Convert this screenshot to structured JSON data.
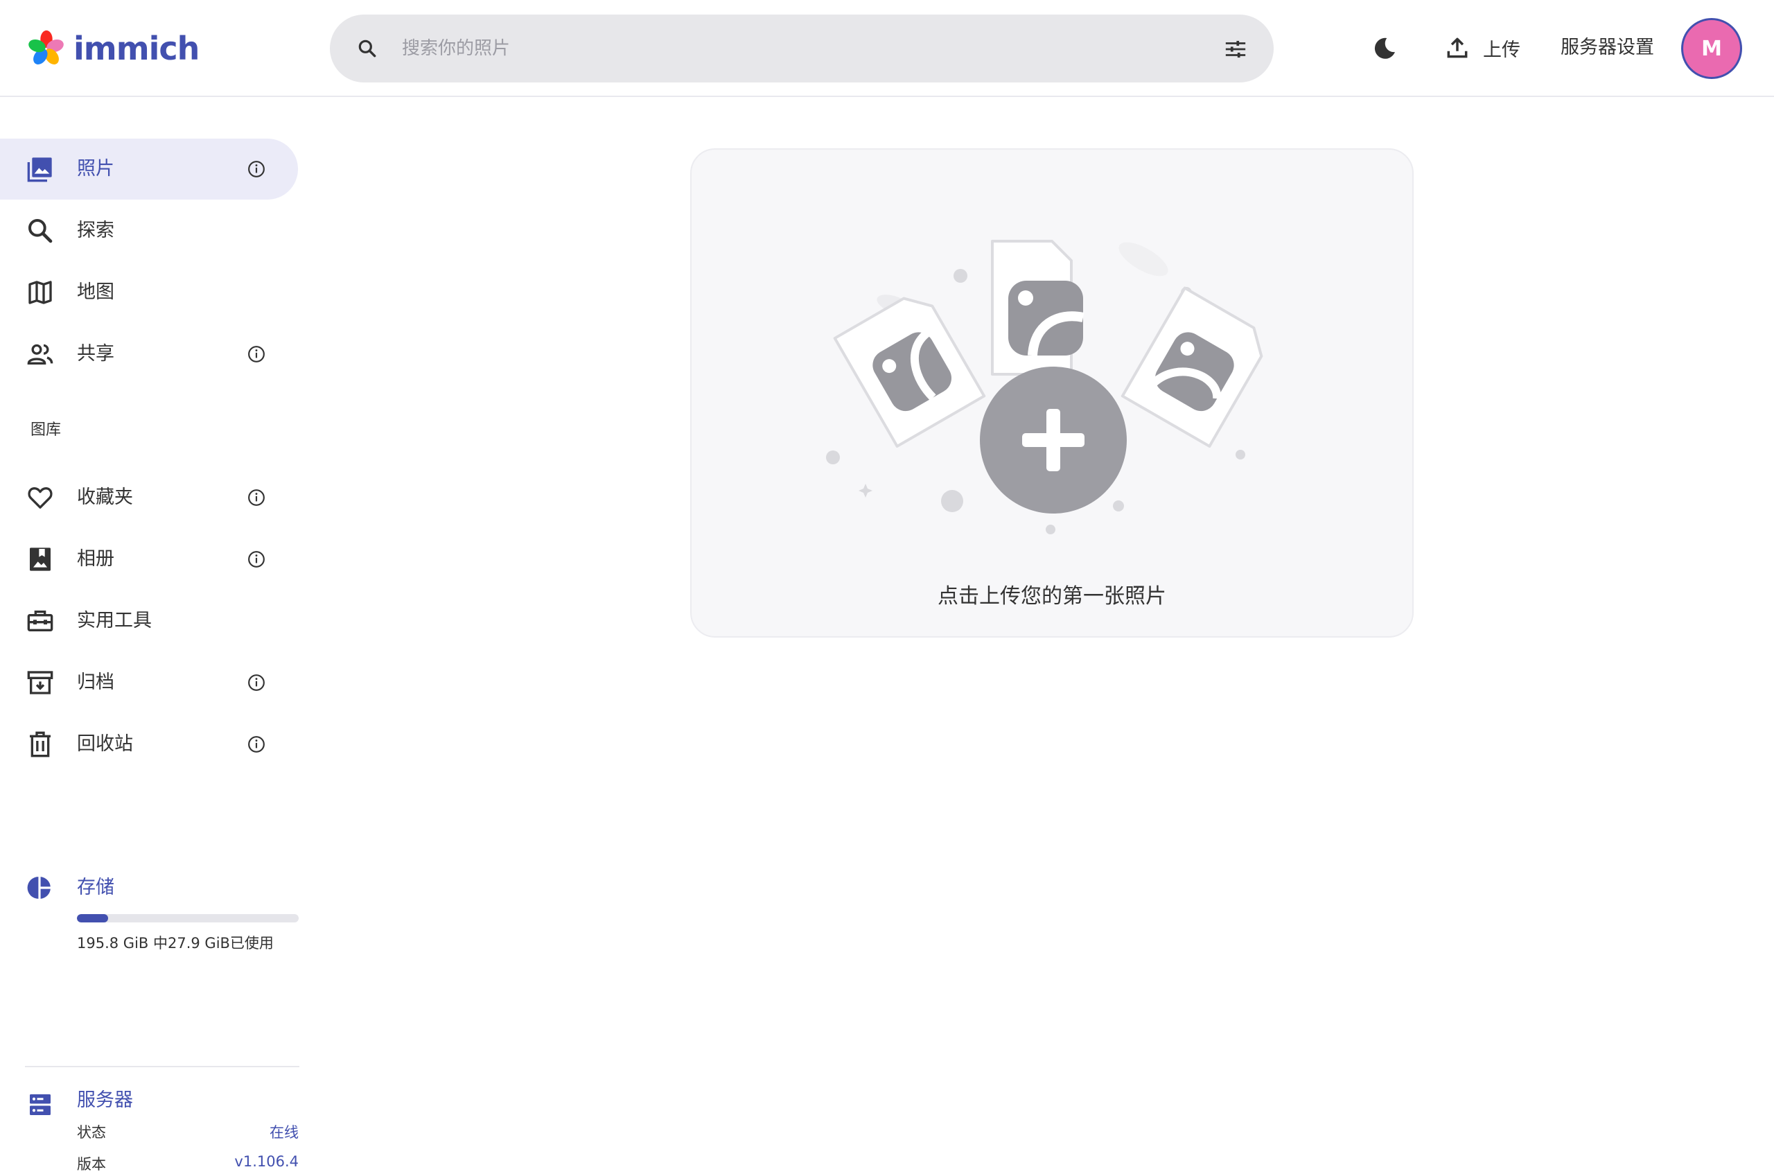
{
  "app": {
    "name": "immich"
  },
  "header": {
    "search_placeholder": "搜索你的照片",
    "upload_label": "上传",
    "server_settings_label": "服务器设置",
    "avatar_initial": "M"
  },
  "sidebar": {
    "items": [
      {
        "label": "照片",
        "icon": "photos-icon",
        "active": true,
        "info": true
      },
      {
        "label": "探索",
        "icon": "search-icon",
        "active": false,
        "info": false
      },
      {
        "label": "地图",
        "icon": "map-icon",
        "active": false,
        "info": false
      },
      {
        "label": "共享",
        "icon": "sharing-icon",
        "active": false,
        "info": true
      }
    ],
    "library_label": "图库",
    "library_items": [
      {
        "label": "收藏夹",
        "icon": "heart-icon",
        "info": true
      },
      {
        "label": "相册",
        "icon": "album-icon",
        "info": true
      },
      {
        "label": "实用工具",
        "icon": "toolbox-icon",
        "info": false
      },
      {
        "label": "归档",
        "icon": "archive-icon",
        "info": true
      },
      {
        "label": "回收站",
        "icon": "trash-icon",
        "info": true
      }
    ],
    "storage": {
      "title": "存储",
      "usage_text": "195.8 GiB 中27.9 GiB已使用",
      "used_fraction": 0.14
    },
    "server": {
      "title": "服务器",
      "status_label": "状态",
      "status_value": "在线",
      "version_label": "版本",
      "version_value": "v1.106.4"
    }
  },
  "main": {
    "empty_message": "点击上传您的第一张照片"
  },
  "colors": {
    "accent": "#4250af",
    "avatar": "#ea6ab0",
    "active_bg": "#ebebf8"
  }
}
